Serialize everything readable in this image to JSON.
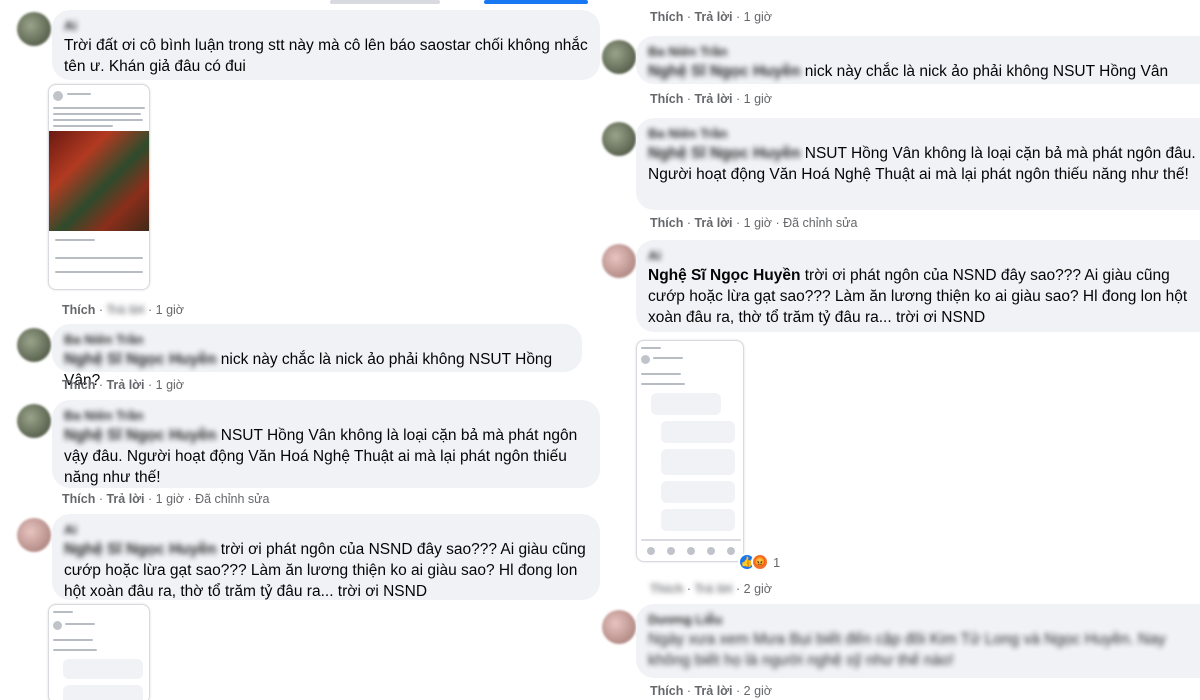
{
  "left": {
    "c1": {
      "name": "Ai",
      "text": "Trời đất ơi cô bình luận trong stt này mà cô lên báo saostar chối không nhắc tên ư. Khán giả đâu có đui",
      "like": "Thích",
      "reply": "Trả lời",
      "time": "1 giờ"
    },
    "c2": {
      "name": "Ba Niên Trần",
      "mention": "Nghệ Sĩ Ngọc Huyền",
      "text": "nick này chắc là nick ảo phải không NSUT Hồng Vân?",
      "like": "Thích",
      "reply": "Trả lời",
      "time": "1 giờ"
    },
    "c3": {
      "name": "Ba Niên Trần",
      "mention": "Nghệ Sĩ Ngọc Huyền",
      "text": "NSUT Hồng Vân không là loại cặn bả mà phát ngôn vậy đâu. Người hoạt động Văn Hoá Nghệ Thuật ai mà lại phát ngôn thiếu năng như thế!",
      "like": "Thích",
      "reply": "Trả lời",
      "time": "1 giờ",
      "edited": "Đã chỉnh sửa"
    },
    "c4": {
      "name": "Ai",
      "mention": "Nghệ Sĩ Ngọc Huyền",
      "text": "trời ơi phát ngôn của NSND đây sao??? Ai giàu cũng cướp hoặc lừa gạt sao??? Làm ăn lương thiện ko ai giàu sao? Hl đong lon hột xoàn đâu ra, thờ tổ trăm tỷ đâu ra... trời ơi NSND"
    }
  },
  "right": {
    "top_meta": {
      "like": "Thích",
      "reply": "Trả lời",
      "time": "1 giờ"
    },
    "c1": {
      "name": "Ba Niên Trần",
      "mention": "Nghệ Sĩ Ngọc Huyền",
      "text": "nick này chắc là nick ảo phải không NSUT Hồng Vân",
      "like": "Thích",
      "reply": "Trả lời",
      "time": "1 giờ"
    },
    "c2": {
      "name": "Ba Niên Trần",
      "mention": "Nghệ Sĩ Ngọc Huyền",
      "text": "NSUT Hồng Vân không là loại cặn bả mà phát ngôn đâu. Người hoạt động Văn Hoá Nghệ Thuật ai mà lại phát ngôn thiếu năng như thế!",
      "like": "Thích",
      "reply": "Trả lời",
      "time": "1 giờ",
      "edited": "Đã chỉnh sửa"
    },
    "c3": {
      "name": "Ai",
      "mention": "Nghệ Sĩ Ngọc Huyền",
      "text": "trời ơi phát ngôn của NSND đây sao??? Ai giàu cũng cướp hoặc lừa gạt sao??? Làm ăn lương thiện ko ai giàu sao? Hl đong lon hột xoàn đâu ra, thờ tổ trăm tỷ đâu ra... trời ơi NSND",
      "reaction_count": "1",
      "like": "Thích",
      "reply": "Trả lời",
      "time": "2 giờ"
    },
    "c4": {
      "name": "Dương Liễu",
      "text": "Ngày xưa xem Mưa Bụi biết đến cặp đôi Kim Tử Long và Ngọc Huyền. Nay không biết họ là người nghệ sỹ như thế nào!",
      "like": "Thích",
      "reply": "Trả lời",
      "time": "2 giờ"
    }
  },
  "colors": {
    "bubble": "#f0f2f5",
    "meta": "#65676b",
    "like_blue": "#1877f2",
    "angry_orange": "#f0742e"
  }
}
